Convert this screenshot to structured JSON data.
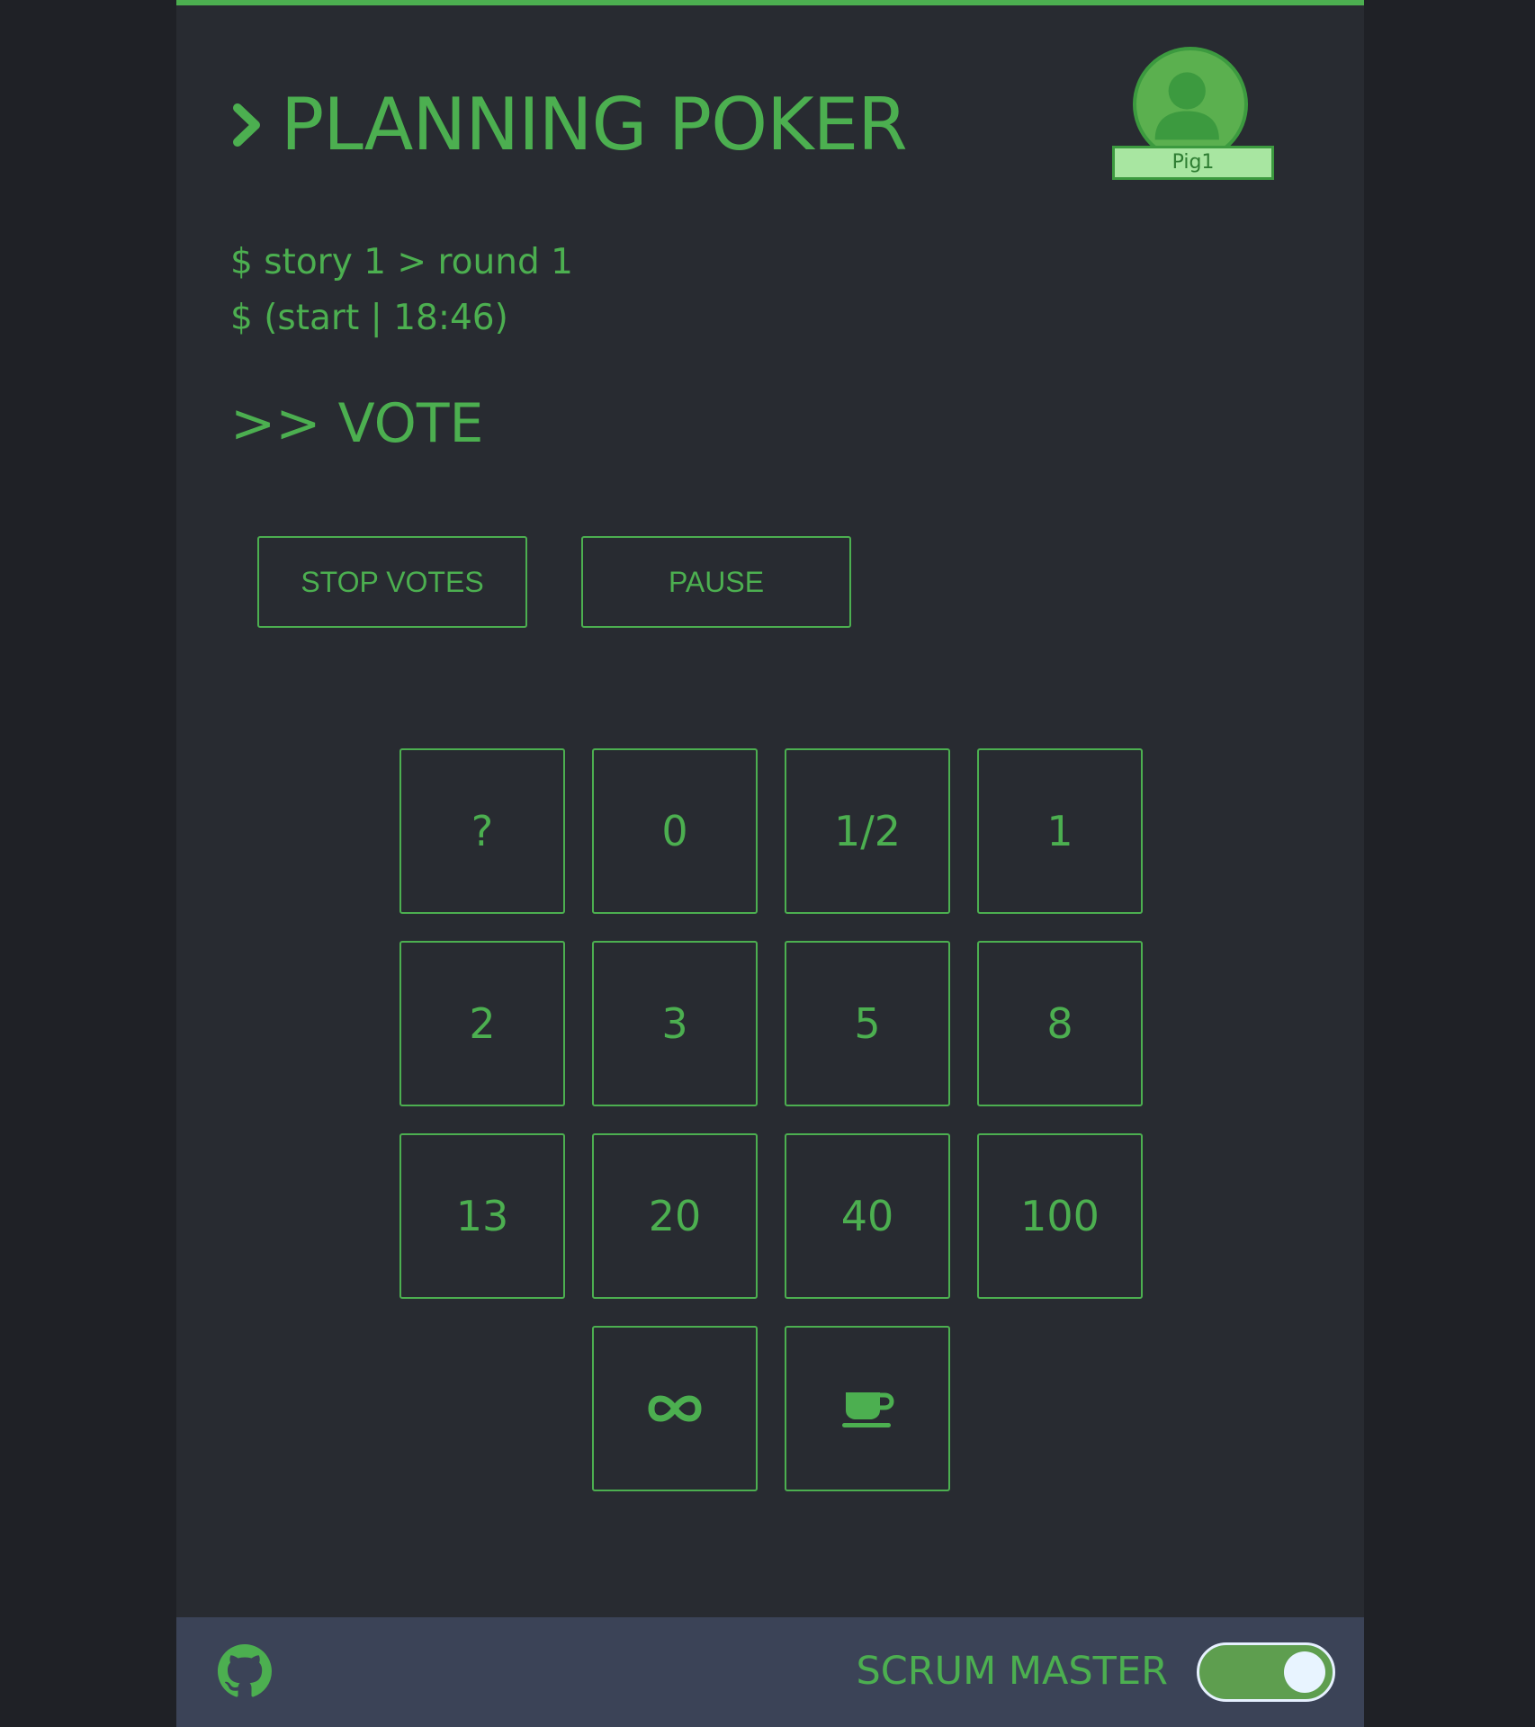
{
  "theme": {
    "accent": "#4caf50",
    "background": "#282b31",
    "outer_background": "#1f2126",
    "footer_background": "#3b4357",
    "name_tag_background": "#a8e6a1",
    "toggle_on": "#5e9e4f"
  },
  "header": {
    "prompt_icon": "chevron-right-icon",
    "title": "PLANNING POKER",
    "user": {
      "avatar_icon": "user-avatar-icon",
      "name": "Pig1"
    }
  },
  "status": {
    "line1": "$ story 1 > round 1",
    "line2": "$ (start | 18:46)"
  },
  "section_title": ">> VOTE",
  "controls": {
    "stop_votes": "STOP VOTES",
    "pause": "PAUSE"
  },
  "cards": [
    {
      "label": "?"
    },
    {
      "label": "0"
    },
    {
      "label": "1/2"
    },
    {
      "label": "1"
    },
    {
      "label": "2"
    },
    {
      "label": "3"
    },
    {
      "label": "5"
    },
    {
      "label": "8"
    },
    {
      "label": "13"
    },
    {
      "label": "20"
    },
    {
      "label": "40"
    },
    {
      "label": "100"
    },
    {
      "icon": "infinity-icon"
    },
    {
      "icon": "coffee-cup-icon"
    }
  ],
  "footer": {
    "github_icon": "github-icon",
    "scrum_master_label": "SCRUM MASTER",
    "scrum_master_enabled": true
  }
}
